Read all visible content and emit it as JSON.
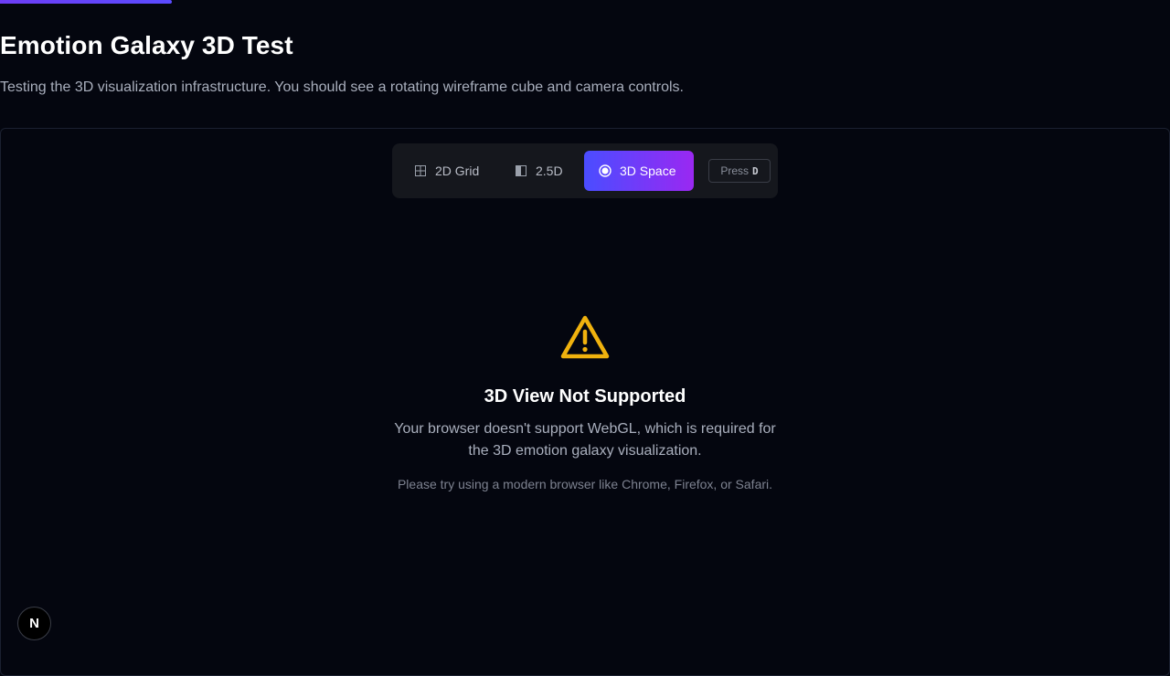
{
  "page": {
    "title": "Emotion Galaxy 3D Test",
    "subtitle": "Testing the 3D visualization infrastructure. You should see a rotating wireframe cube and camera controls."
  },
  "mode_switcher": {
    "options": [
      {
        "label": "2D Grid",
        "icon": "grid-icon",
        "active": false
      },
      {
        "label": "2.5D",
        "icon": "layers-icon",
        "active": false
      },
      {
        "label": "3D Space",
        "icon": "radio-icon",
        "active": true
      }
    ],
    "shortcut_prefix": "Press",
    "shortcut_key": "D"
  },
  "message": {
    "icon": "warning-icon",
    "title": "3D View Not Supported",
    "body": "Your browser doesn't support WebGL, which is required for the 3D emotion galaxy visualization.",
    "hint": "Please try using a modern browser like Chrome, Firefox, or Safari."
  },
  "dev_badge": {
    "letter": "N",
    "icon": "nextjs-icon"
  },
  "colors": {
    "background": "#04060f",
    "accent_start": "#4a4dff",
    "accent_end": "#9a28f2",
    "warning": "#f0b20e"
  }
}
